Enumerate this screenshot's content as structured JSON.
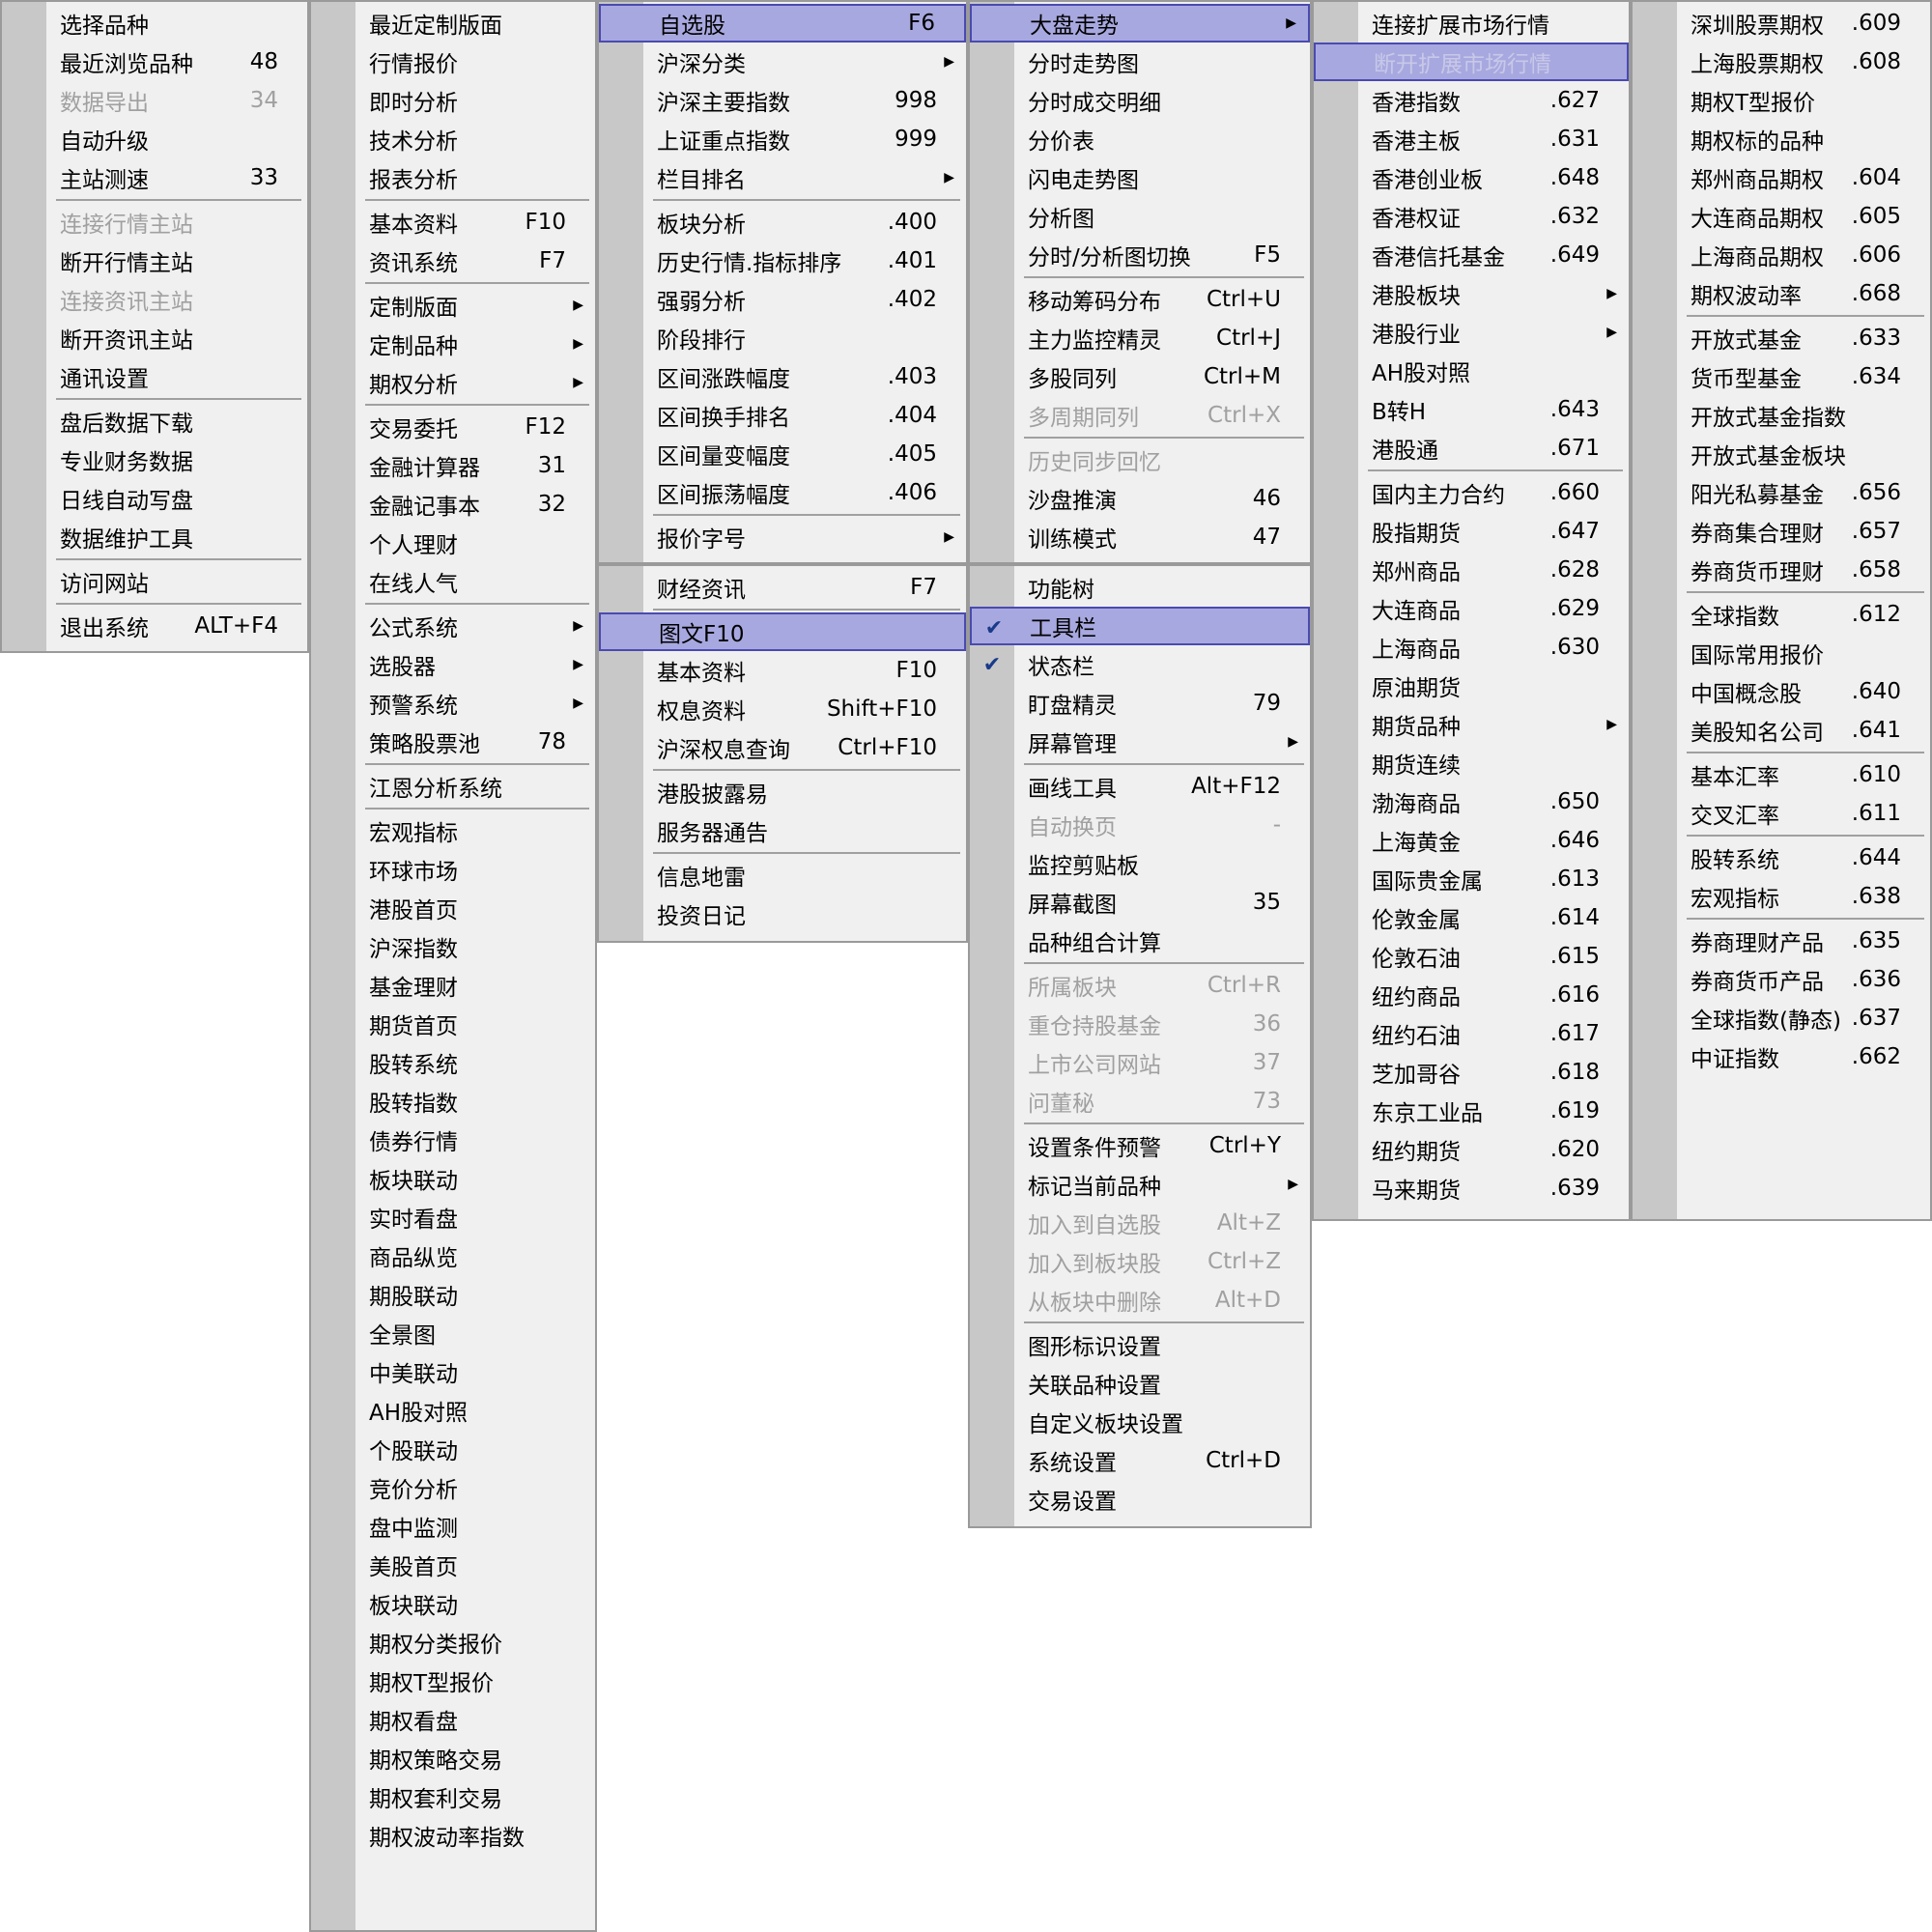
{
  "menus": {
    "m1": [
      {
        "label": "选择品种",
        "sc": ""
      },
      {
        "label": "最近浏览品种",
        "sc": "48"
      },
      {
        "label": "数据导出",
        "sc": "34",
        "dis": true
      },
      {
        "label": "自动升级",
        "sc": ""
      },
      {
        "label": "主站测速",
        "sc": "33"
      },
      {
        "sep": true
      },
      {
        "label": "连接行情主站",
        "dis": true
      },
      {
        "label": "断开行情主站"
      },
      {
        "label": "连接资讯主站",
        "dis": true
      },
      {
        "label": "断开资讯主站"
      },
      {
        "label": "通讯设置"
      },
      {
        "sep": true
      },
      {
        "label": "盘后数据下载"
      },
      {
        "label": "专业财务数据"
      },
      {
        "label": "日线自动写盘"
      },
      {
        "label": "数据维护工具"
      },
      {
        "sep": true
      },
      {
        "label": "访问网站"
      },
      {
        "sep": true
      },
      {
        "label": "退出系统",
        "sc": "ALT+F4"
      }
    ],
    "m2": [
      {
        "label": "最近定制版面"
      },
      {
        "label": "行情报价"
      },
      {
        "label": "即时分析"
      },
      {
        "label": "技术分析"
      },
      {
        "label": "报表分析"
      },
      {
        "sep": true
      },
      {
        "label": "基本资料",
        "sc": "F10"
      },
      {
        "label": "资讯系统",
        "sc": "F7"
      },
      {
        "sep": true
      },
      {
        "label": "定制版面",
        "arrow": true
      },
      {
        "label": "定制品种",
        "arrow": true
      },
      {
        "label": "期权分析",
        "arrow": true
      },
      {
        "sep": true
      },
      {
        "label": "交易委托",
        "sc": "F12"
      },
      {
        "label": "金融计算器",
        "sc": "31"
      },
      {
        "label": "金融记事本",
        "sc": "32"
      },
      {
        "label": "个人理财"
      },
      {
        "label": "在线人气"
      },
      {
        "sep": true
      },
      {
        "label": "公式系统",
        "arrow": true
      },
      {
        "label": "选股器",
        "arrow": true
      },
      {
        "label": "预警系统",
        "arrow": true
      },
      {
        "label": "策略股票池",
        "sc": "78"
      },
      {
        "sep": true
      },
      {
        "label": "江恩分析系统"
      },
      {
        "sep": true
      },
      {
        "label": "宏观指标"
      },
      {
        "label": "环球市场"
      },
      {
        "label": "港股首页"
      },
      {
        "label": "沪深指数"
      },
      {
        "label": "基金理财"
      },
      {
        "label": "期货首页"
      },
      {
        "label": "股转系统"
      },
      {
        "label": "股转指数"
      },
      {
        "label": "债券行情"
      },
      {
        "label": "板块联动"
      },
      {
        "label": "实时看盘"
      },
      {
        "label": "商品纵览"
      },
      {
        "label": "期股联动"
      },
      {
        "label": "全景图"
      },
      {
        "label": "中美联动"
      },
      {
        "label": "AH股对照"
      },
      {
        "label": "个股联动"
      },
      {
        "label": "竞价分析"
      },
      {
        "label": "盘中监测"
      },
      {
        "label": "美股首页"
      },
      {
        "label": "板块联动"
      },
      {
        "label": "期权分类报价"
      },
      {
        "label": "期权T型报价"
      },
      {
        "label": "期权看盘"
      },
      {
        "label": "期权策略交易"
      },
      {
        "label": "期权套利交易"
      },
      {
        "label": "期权波动率指数"
      }
    ],
    "m3": [
      {
        "label": "自选股",
        "sc": "F6",
        "sel": true
      },
      {
        "label": "沪深分类",
        "arrow": true
      },
      {
        "label": "沪深主要指数",
        "sc": "998"
      },
      {
        "label": "上证重点指数",
        "sc": "999"
      },
      {
        "label": "栏目排名",
        "arrow": true
      },
      {
        "sep": true
      },
      {
        "label": "板块分析",
        "sc": ".400"
      },
      {
        "label": "历史行情.指标排序",
        "sc": ".401"
      },
      {
        "label": "强弱分析",
        "sc": ".402"
      },
      {
        "label": "阶段排行"
      },
      {
        "label": "区间涨跌幅度",
        "sc": ".403"
      },
      {
        "label": "区间换手排名",
        "sc": ".404"
      },
      {
        "label": "区间量变幅度",
        "sc": ".405"
      },
      {
        "label": "区间振荡幅度",
        "sc": ".406"
      },
      {
        "sep": true
      },
      {
        "label": "报价字号",
        "arrow": true
      }
    ],
    "m4": [
      {
        "label": "财经资讯",
        "sc": "F7"
      },
      {
        "sep": true
      },
      {
        "label": "图文F10",
        "sel": true
      },
      {
        "label": "基本资料",
        "sc": "F10"
      },
      {
        "label": "权息资料",
        "sc": "Shift+F10"
      },
      {
        "label": "沪深权息查询",
        "sc": "Ctrl+F10"
      },
      {
        "sep": true
      },
      {
        "label": "港股披露易"
      },
      {
        "label": "服务器通告"
      },
      {
        "sep": true
      },
      {
        "label": "信息地雷"
      },
      {
        "label": "投资日记"
      }
    ],
    "m5": [
      {
        "label": "大盘走势",
        "sel": true,
        "arrow": true
      },
      {
        "label": "分时走势图"
      },
      {
        "label": "分时成交明细"
      },
      {
        "label": "分价表"
      },
      {
        "label": "闪电走势图"
      },
      {
        "label": "分析图"
      },
      {
        "label": "分时/分析图切换",
        "sc": "F5"
      },
      {
        "sep": true
      },
      {
        "label": "移动筹码分布",
        "sc": "Ctrl+U"
      },
      {
        "label": "主力监控精灵",
        "sc": "Ctrl+J"
      },
      {
        "label": "多股同列",
        "sc": "Ctrl+M"
      },
      {
        "label": "多周期同列",
        "sc": "Ctrl+X",
        "dis": true
      },
      {
        "sep": true
      },
      {
        "label": "历史同步回忆",
        "dis": true
      },
      {
        "label": "沙盘推演",
        "sc": "46"
      },
      {
        "label": "训练模式",
        "sc": "47"
      }
    ],
    "m6": [
      {
        "label": "功能树"
      },
      {
        "label": "工具栏",
        "sel": true,
        "check": true
      },
      {
        "label": "状态栏",
        "check": true
      },
      {
        "label": "盯盘精灵",
        "sc": "79"
      },
      {
        "label": "屏幕管理",
        "arrow": true
      },
      {
        "sep": true
      },
      {
        "label": "画线工具",
        "sc": "Alt+F12"
      },
      {
        "label": "自动换页",
        "sc": "-",
        "dis": true
      },
      {
        "label": "监控剪贴板"
      },
      {
        "label": "屏幕截图",
        "sc": "35"
      },
      {
        "label": "品种组合计算"
      },
      {
        "sep": true
      },
      {
        "label": "所属板块",
        "sc": "Ctrl+R",
        "dis": true
      },
      {
        "label": "重仓持股基金",
        "sc": "36",
        "dis": true
      },
      {
        "label": "上市公司网站",
        "sc": "37",
        "dis": true
      },
      {
        "label": "问董秘",
        "sc": "73",
        "dis": true
      },
      {
        "sep": true
      },
      {
        "label": "设置条件预警",
        "sc": "Ctrl+Y"
      },
      {
        "label": "标记当前品种",
        "arrow": true
      },
      {
        "label": "加入到自选股",
        "sc": "Alt+Z",
        "dis": true
      },
      {
        "label": "加入到板块股",
        "sc": "Ctrl+Z",
        "dis": true
      },
      {
        "label": "从板块中删除",
        "sc": "Alt+D",
        "dis": true
      },
      {
        "sep": true
      },
      {
        "label": "图形标识设置"
      },
      {
        "label": "关联品种设置"
      },
      {
        "label": "自定义板块设置"
      },
      {
        "label": "系统设置",
        "sc": "Ctrl+D"
      },
      {
        "label": "交易设置"
      }
    ],
    "m7": [
      {
        "label": "连接扩展市场行情"
      },
      {
        "label": "断开扩展市场行情",
        "sel": true,
        "dis": true
      },
      {
        "label": "香港指数",
        "sc": ".627"
      },
      {
        "label": "香港主板",
        "sc": ".631"
      },
      {
        "label": "香港创业板",
        "sc": ".648"
      },
      {
        "label": "香港权证",
        "sc": ".632"
      },
      {
        "label": "香港信托基金",
        "sc": ".649"
      },
      {
        "label": "港股板块",
        "arrow": true
      },
      {
        "label": "港股行业",
        "arrow": true
      },
      {
        "label": "AH股对照"
      },
      {
        "label": "B转H",
        "sc": ".643"
      },
      {
        "label": "港股通",
        "sc": ".671"
      },
      {
        "sep": true
      },
      {
        "label": "国内主力合约",
        "sc": ".660"
      },
      {
        "label": "股指期货",
        "sc": ".647"
      },
      {
        "label": "郑州商品",
        "sc": ".628"
      },
      {
        "label": "大连商品",
        "sc": ".629"
      },
      {
        "label": "上海商品",
        "sc": ".630"
      },
      {
        "label": "原油期货"
      },
      {
        "label": "期货品种",
        "arrow": true
      },
      {
        "label": "期货连续"
      },
      {
        "label": "渤海商品",
        "sc": ".650"
      },
      {
        "label": "上海黄金",
        "sc": ".646"
      },
      {
        "label": "国际贵金属",
        "sc": ".613"
      },
      {
        "label": "伦敦金属",
        "sc": ".614"
      },
      {
        "label": "伦敦石油",
        "sc": ".615"
      },
      {
        "label": "纽约商品",
        "sc": ".616"
      },
      {
        "label": "纽约石油",
        "sc": ".617"
      },
      {
        "label": "芝加哥谷",
        "sc": ".618"
      },
      {
        "label": "东京工业品",
        "sc": ".619"
      },
      {
        "label": "纽约期货",
        "sc": ".620"
      },
      {
        "label": "马来期货",
        "sc": ".639"
      }
    ],
    "m8": [
      {
        "label": "深圳股票期权",
        "sc": ".609"
      },
      {
        "label": "上海股票期权",
        "sc": ".608"
      },
      {
        "label": "期权T型报价"
      },
      {
        "label": "期权标的品种"
      },
      {
        "label": "郑州商品期权",
        "sc": ".604"
      },
      {
        "label": "大连商品期权",
        "sc": ".605"
      },
      {
        "label": "上海商品期权",
        "sc": ".606"
      },
      {
        "label": "期权波动率",
        "sc": ".668"
      },
      {
        "sep": true
      },
      {
        "label": "开放式基金",
        "sc": ".633"
      },
      {
        "label": "货币型基金",
        "sc": ".634"
      },
      {
        "label": "开放式基金指数"
      },
      {
        "label": "开放式基金板块"
      },
      {
        "label": "阳光私募基金",
        "sc": ".656"
      },
      {
        "label": "券商集合理财",
        "sc": ".657"
      },
      {
        "label": "券商货币理财",
        "sc": ".658"
      },
      {
        "sep": true
      },
      {
        "label": "全球指数",
        "sc": ".612"
      },
      {
        "label": "国际常用报价"
      },
      {
        "label": "中国概念股",
        "sc": ".640"
      },
      {
        "label": "美股知名公司",
        "sc": ".641"
      },
      {
        "sep": true
      },
      {
        "label": "基本汇率",
        "sc": ".610"
      },
      {
        "label": "交叉汇率",
        "sc": ".611"
      },
      {
        "sep": true
      },
      {
        "label": "股转系统",
        "sc": ".644"
      },
      {
        "label": "宏观指标",
        "sc": ".638"
      },
      {
        "sep": true
      },
      {
        "label": "券商理财产品",
        "sc": ".635"
      },
      {
        "label": "券商货币产品",
        "sc": ".636"
      },
      {
        "label": "全球指数(静态)",
        "sc": ".637"
      },
      {
        "label": "中证指数",
        "sc": ".662"
      }
    ]
  }
}
